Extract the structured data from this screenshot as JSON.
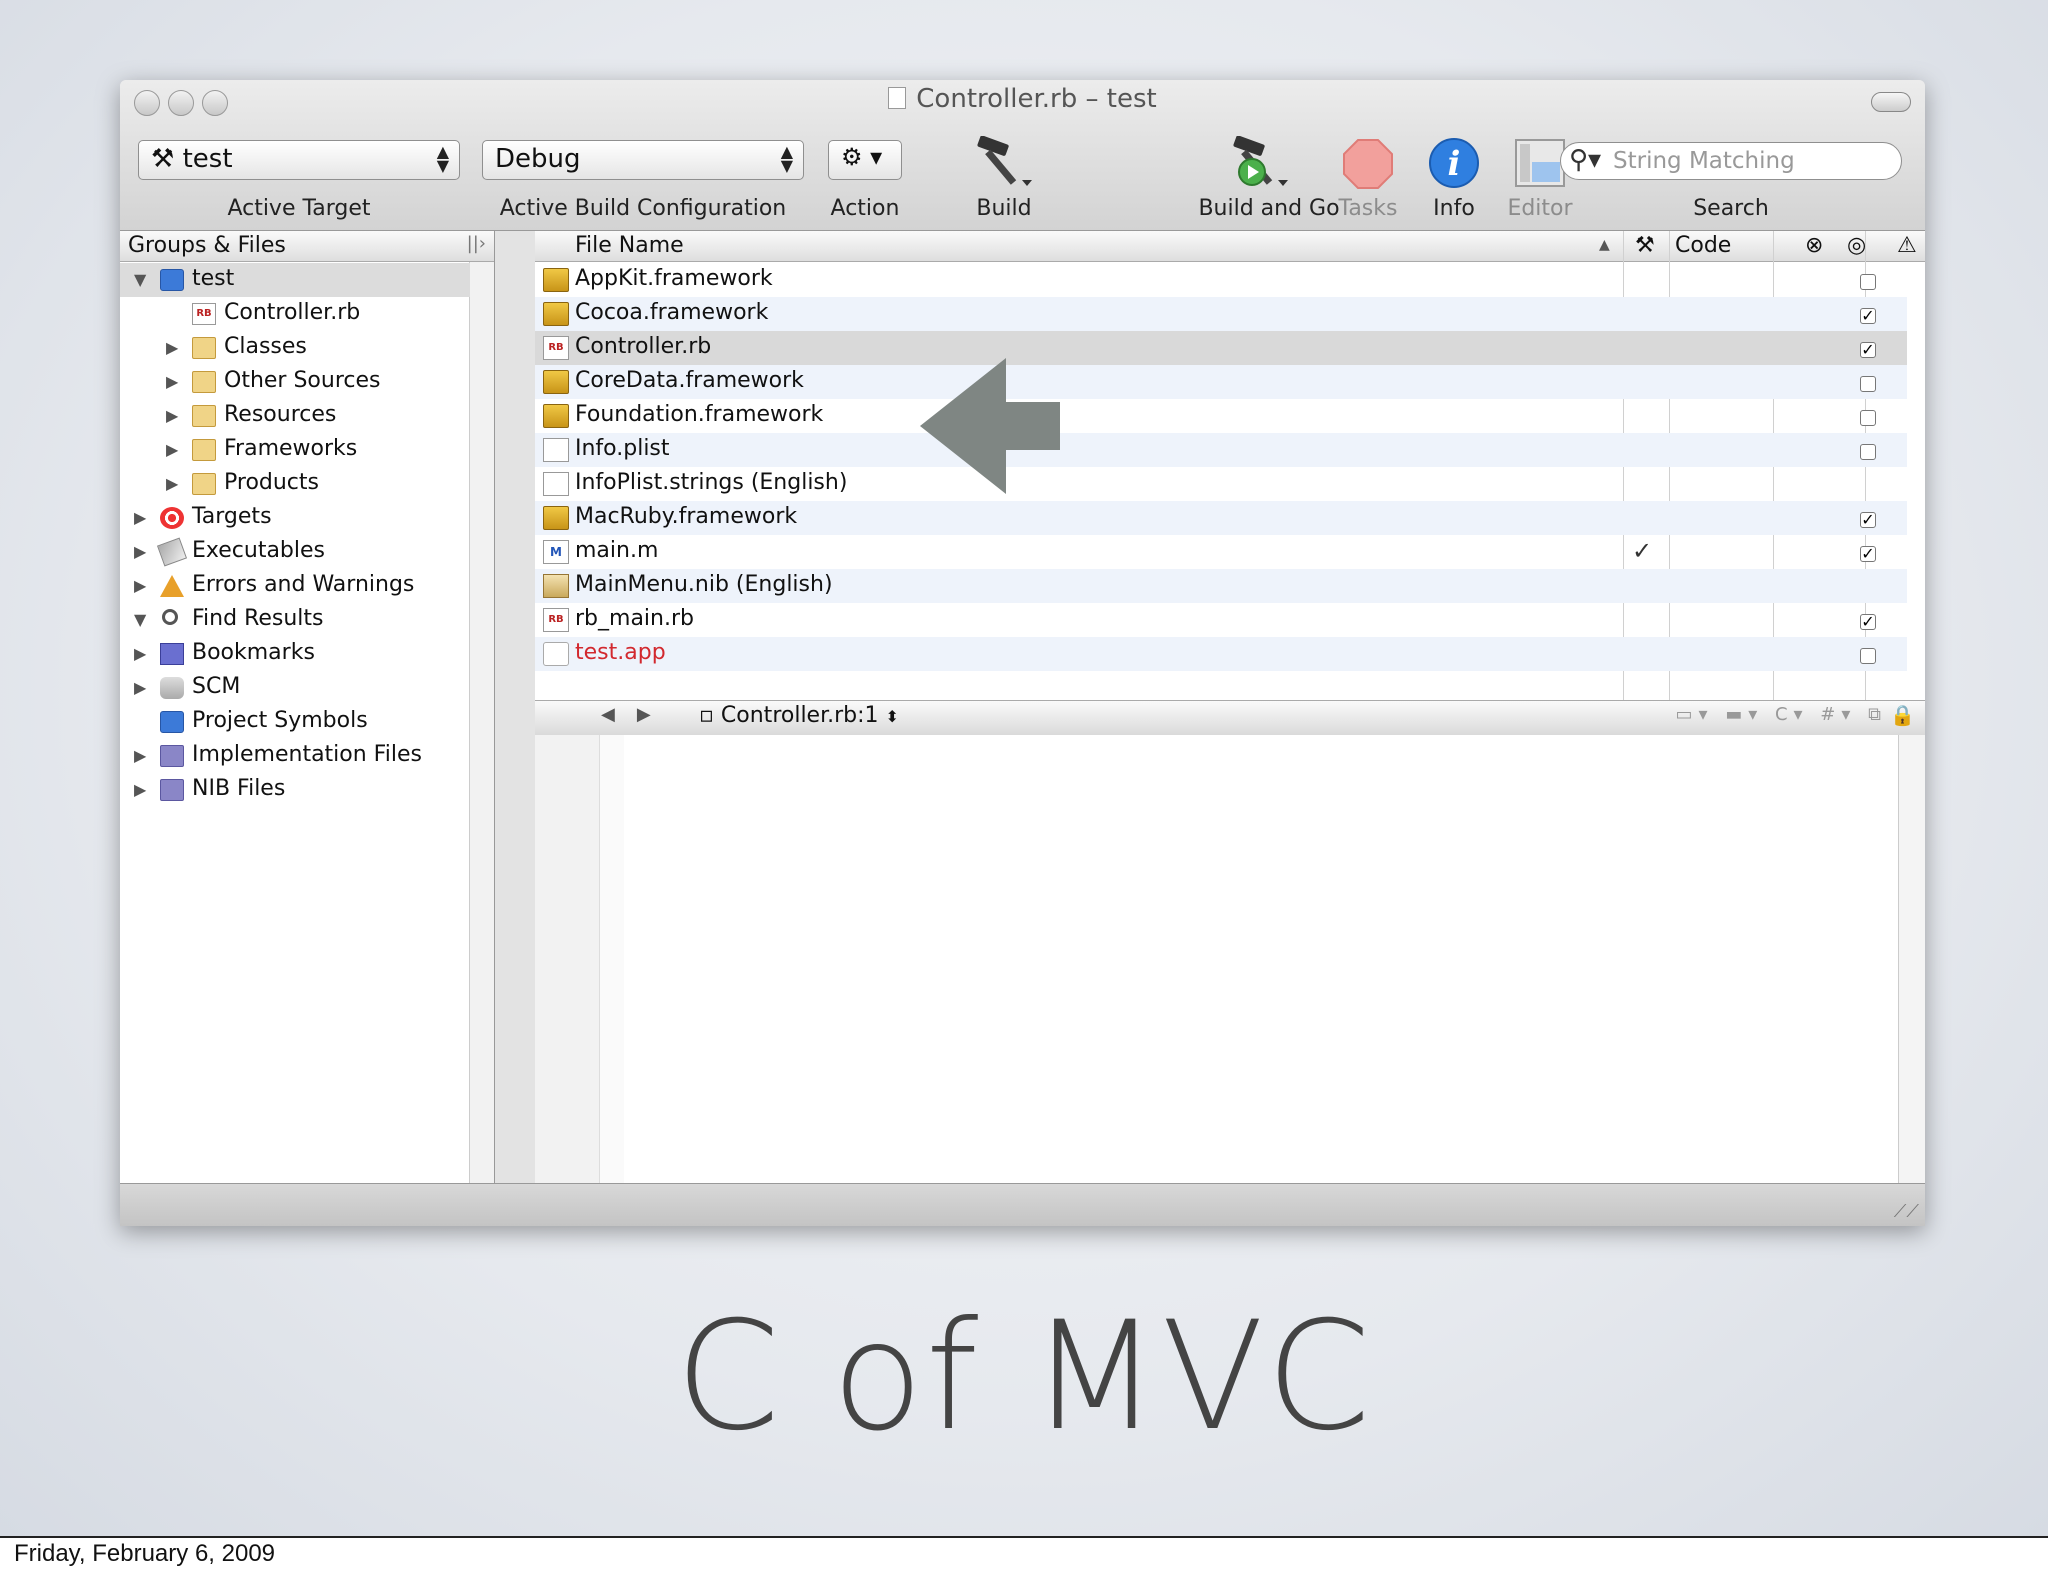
{
  "window": {
    "title": "Controller.rb – test"
  },
  "toolbar": {
    "active_target": "test",
    "active_target_label": "Active Target",
    "build_config": "Debug",
    "build_config_label": "Active Build Configuration",
    "action_label": "Action",
    "build_label": "Build",
    "build_and_go_label": "Build and Go",
    "tasks_label": "Tasks",
    "info_label": "Info",
    "editor_label": "Editor",
    "search_placeholder": "String Matching",
    "search_label": "Search"
  },
  "sidebar": {
    "header": "Groups & Files",
    "items": [
      {
        "label": "test",
        "icon": "project-icon",
        "expanded": true,
        "level": 0,
        "selected": true
      },
      {
        "label": "Controller.rb",
        "icon": "ruby-file-icon",
        "level": 1
      },
      {
        "label": "Classes",
        "icon": "folder-icon",
        "level": 1
      },
      {
        "label": "Other Sources",
        "icon": "folder-icon",
        "level": 1
      },
      {
        "label": "Resources",
        "icon": "folder-icon",
        "level": 1
      },
      {
        "label": "Frameworks",
        "icon": "folder-icon",
        "level": 1
      },
      {
        "label": "Products",
        "icon": "folder-icon",
        "level": 1
      },
      {
        "label": "Targets",
        "icon": "target-icon",
        "level": 0
      },
      {
        "label": "Executables",
        "icon": "executable-icon",
        "level": 0
      },
      {
        "label": "Errors and Warnings",
        "icon": "warning-icon",
        "level": 0
      },
      {
        "label": "Find Results",
        "icon": "magnifier-icon",
        "level": 0,
        "expanded": true
      },
      {
        "label": "Bookmarks",
        "icon": "bookmarks-icon",
        "level": 0
      },
      {
        "label": "SCM",
        "icon": "scm-icon",
        "level": 0
      },
      {
        "label": "Project Symbols",
        "icon": "symbols-icon",
        "level": 0
      },
      {
        "label": "Implementation Files",
        "icon": "smart-group-icon",
        "level": 0
      },
      {
        "label": "NIB Files",
        "icon": "smart-group-icon",
        "level": 0
      }
    ]
  },
  "filelist": {
    "columns": {
      "file_name": "File Name",
      "code": "Code"
    },
    "rows": [
      {
        "name": "AppKit.framework",
        "icon": "framework-icon",
        "target": false
      },
      {
        "name": "Cocoa.framework",
        "icon": "framework-icon",
        "target": true
      },
      {
        "name": "Controller.rb",
        "icon": "ruby-file-icon",
        "target": true,
        "selected": true
      },
      {
        "name": "CoreData.framework",
        "icon": "framework-icon",
        "target": false
      },
      {
        "name": "Foundation.framework",
        "icon": "framework-icon",
        "target": false
      },
      {
        "name": "Info.plist",
        "icon": "plist-icon",
        "target": false
      },
      {
        "name": "InfoPlist.strings (English)",
        "icon": "plist-icon",
        "target": null
      },
      {
        "name": "MacRuby.framework",
        "icon": "framework-icon",
        "target": true
      },
      {
        "name": "main.m",
        "icon": "m-file-icon",
        "target": true,
        "build": true
      },
      {
        "name": "MainMenu.nib (English)",
        "icon": "nib-icon",
        "target": null
      },
      {
        "name": "rb_main.rb",
        "icon": "ruby-file-icon",
        "target": true
      },
      {
        "name": "test.app",
        "icon": "app-icon",
        "target": false,
        "missing": true
      }
    ]
  },
  "editor": {
    "file_popup": "Controller.rb:1"
  },
  "slide": {
    "title": "C of MVC",
    "footer": "Friday, February 6, 2009"
  },
  "colors": {
    "missing_file": "#d2282e",
    "selected_row": "#d9d9d9",
    "arrow": "#7f8683"
  }
}
